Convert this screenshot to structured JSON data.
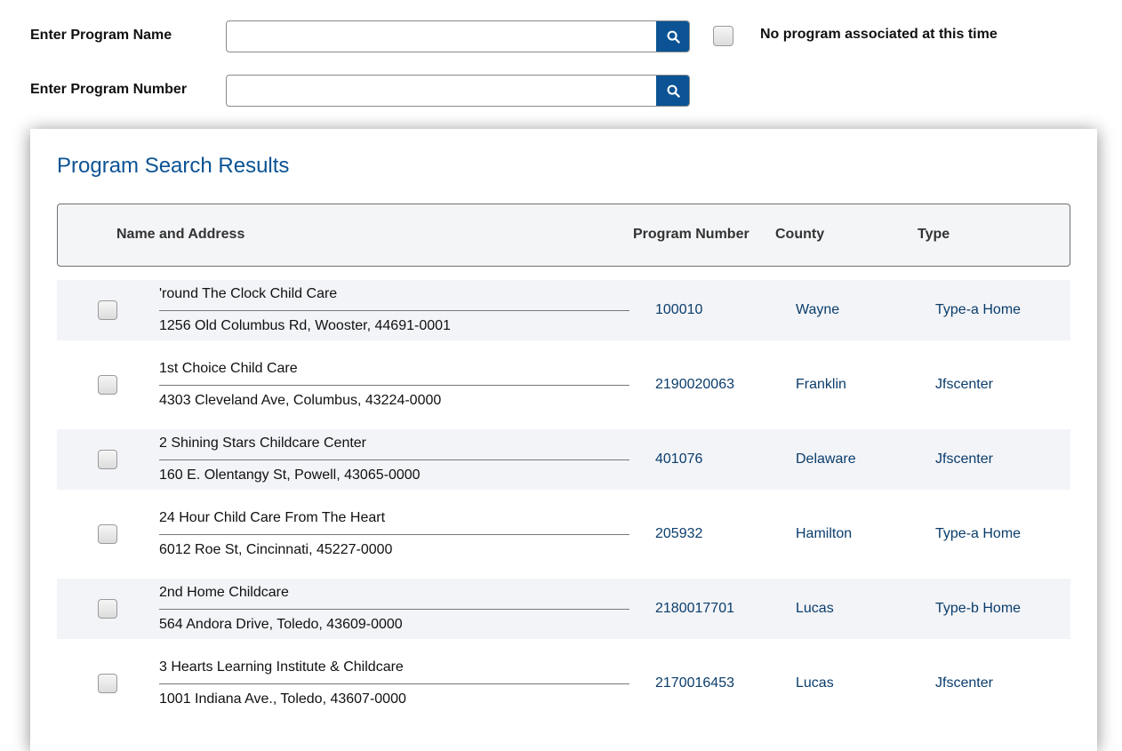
{
  "search": {
    "program_name_label": "Enter Program Name",
    "program_name_value": "",
    "program_number_label": "Enter Program Number",
    "program_number_value": "",
    "no_program_label": "No program associated at this time"
  },
  "results": {
    "title": "Program Search Results",
    "columns": {
      "name_address": "Name and Address",
      "program_number": "Program Number",
      "county": "County",
      "type": "Type"
    },
    "rows": [
      {
        "name": "'round The Clock Child Care",
        "address": "1256 Old Columbus Rd, Wooster, 44691-0001",
        "number": "100010",
        "county": "Wayne",
        "type": "Type-a Home"
      },
      {
        "name": "1st Choice Child Care",
        "address": "4303 Cleveland Ave, Columbus, 43224-0000",
        "number": "2190020063",
        "county": "Franklin",
        "type": "Jfscenter"
      },
      {
        "name": "2 Shining Stars Childcare Center",
        "address": "160 E. Olentangy St, Powell, 43065-0000",
        "number": "401076",
        "county": "Delaware",
        "type": "Jfscenter"
      },
      {
        "name": "24 Hour Child Care From The Heart",
        "address": "6012 Roe St, Cincinnati, 45227-0000",
        "number": "205932",
        "county": "Hamilton",
        "type": "Type-a Home"
      },
      {
        "name": "2nd Home Childcare",
        "address": "564 Andora Drive, Toledo, 43609-0000",
        "number": "2180017701",
        "county": "Lucas",
        "type": "Type-b Home"
      },
      {
        "name": "3 Hearts Learning Institute & Childcare",
        "address": "1001 Indiana Ave., Toledo, 43607-0000",
        "number": "2170016453",
        "county": "Lucas",
        "type": "Jfscenter"
      }
    ]
  },
  "colors": {
    "accent": "#0b5394",
    "link": "#0a3d6b",
    "row_shade": "#f3f4f8"
  }
}
